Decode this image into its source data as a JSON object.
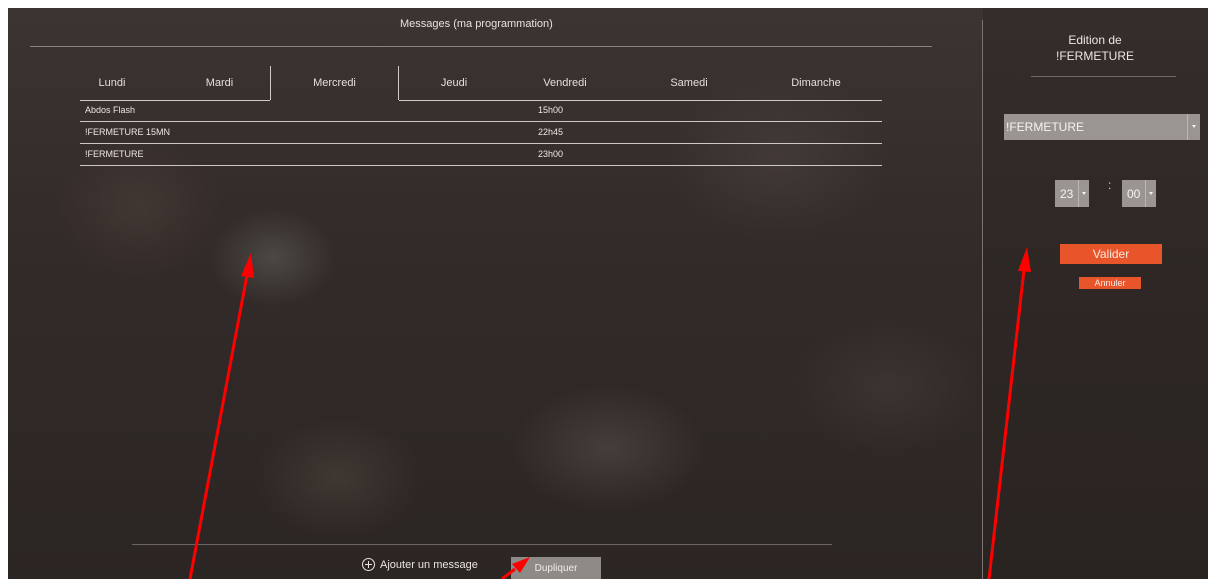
{
  "main": {
    "title": "Messages (ma programmation)",
    "tabs": [
      {
        "label": "Lundi"
      },
      {
        "label": "Mardi"
      },
      {
        "label": "Mercredi"
      },
      {
        "label": "Jeudi"
      },
      {
        "label": "Vendredi"
      },
      {
        "label": "Samedi"
      },
      {
        "label": "Dimanche"
      }
    ],
    "active_tab": "Mercredi",
    "messages": [
      {
        "name": "Abdos Flash",
        "time": "15h00"
      },
      {
        "name": "!FERMETURE 15MN",
        "time": "22h45"
      },
      {
        "name": "!FERMETURE",
        "time": "23h00"
      }
    ],
    "add_label": "Ajouter un message",
    "duplicate_label": "Dupliquer"
  },
  "edit": {
    "heading_line1": "Edition de",
    "heading_line2": "!FERMETURE",
    "message_select": "!FERMETURE",
    "hour": "23",
    "minute": "00",
    "separator": ":",
    "validate_label": "Valider",
    "cancel_label": "Annuler"
  },
  "colors": {
    "accent": "#e8552a",
    "annotation_arrow": "#ff0000"
  }
}
